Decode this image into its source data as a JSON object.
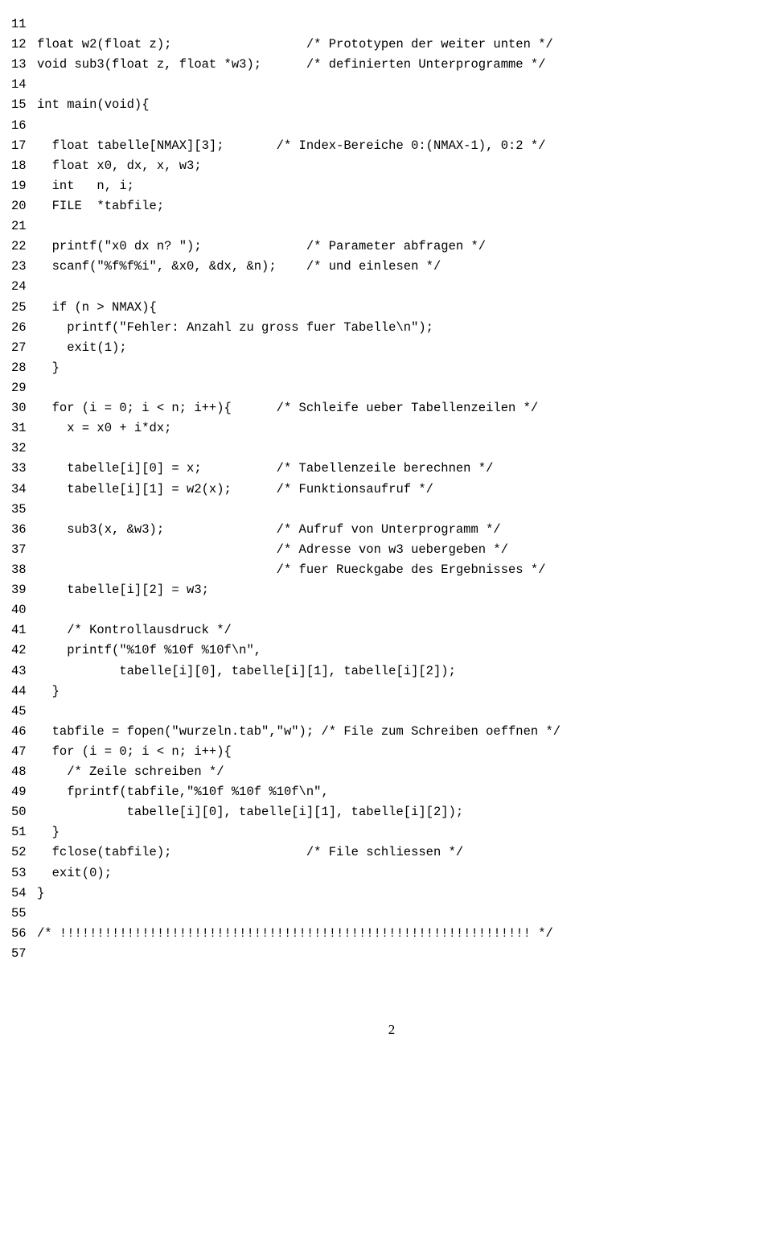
{
  "code_lines": [
    {
      "num": "11",
      "text": ""
    },
    {
      "num": "12",
      "text": "float w2(float z);                  /* Prototypen der weiter unten */"
    },
    {
      "num": "13",
      "text": "void sub3(float z, float *w3);      /* definierten Unterprogramme */"
    },
    {
      "num": "14",
      "text": ""
    },
    {
      "num": "15",
      "text": "int main(void){"
    },
    {
      "num": "16",
      "text": ""
    },
    {
      "num": "17",
      "text": "  float tabelle[NMAX][3];       /* Index-Bereiche 0:(NMAX-1), 0:2 */"
    },
    {
      "num": "18",
      "text": "  float x0, dx, x, w3;"
    },
    {
      "num": "19",
      "text": "  int   n, i;"
    },
    {
      "num": "20",
      "text": "  FILE  *tabfile;"
    },
    {
      "num": "21",
      "text": ""
    },
    {
      "num": "22",
      "text": "  printf(\"x0 dx n? \");              /* Parameter abfragen */"
    },
    {
      "num": "23",
      "text": "  scanf(\"%f%f%i\", &x0, &dx, &n);    /* und einlesen */"
    },
    {
      "num": "24",
      "text": ""
    },
    {
      "num": "25",
      "text": "  if (n > NMAX){"
    },
    {
      "num": "26",
      "text": "    printf(\"Fehler: Anzahl zu gross fuer Tabelle\\n\");"
    },
    {
      "num": "27",
      "text": "    exit(1);"
    },
    {
      "num": "28",
      "text": "  }"
    },
    {
      "num": "29",
      "text": ""
    },
    {
      "num": "30",
      "text": "  for (i = 0; i < n; i++){      /* Schleife ueber Tabellenzeilen */"
    },
    {
      "num": "31",
      "text": "    x = x0 + i*dx;"
    },
    {
      "num": "32",
      "text": ""
    },
    {
      "num": "33",
      "text": "    tabelle[i][0] = x;          /* Tabellenzeile berechnen */"
    },
    {
      "num": "34",
      "text": "    tabelle[i][1] = w2(x);      /* Funktionsaufruf */"
    },
    {
      "num": "35",
      "text": ""
    },
    {
      "num": "36",
      "text": "    sub3(x, &w3);               /* Aufruf von Unterprogramm */"
    },
    {
      "num": "37",
      "text": "                                /* Adresse von w3 uebergeben */"
    },
    {
      "num": "38",
      "text": "                                /* fuer Rueckgabe des Ergebnisses */"
    },
    {
      "num": "39",
      "text": "    tabelle[i][2] = w3;"
    },
    {
      "num": "40",
      "text": ""
    },
    {
      "num": "41",
      "text": "    /* Kontrollausdruck */"
    },
    {
      "num": "42",
      "text": "    printf(\"%10f %10f %10f\\n\","
    },
    {
      "num": "43",
      "text": "           tabelle[i][0], tabelle[i][1], tabelle[i][2]);"
    },
    {
      "num": "44",
      "text": "  }"
    },
    {
      "num": "45",
      "text": ""
    },
    {
      "num": "46",
      "text": "  tabfile = fopen(\"wurzeln.tab\",\"w\"); /* File zum Schreiben oeffnen */"
    },
    {
      "num": "47",
      "text": "  for (i = 0; i < n; i++){"
    },
    {
      "num": "48",
      "text": "    /* Zeile schreiben */"
    },
    {
      "num": "49",
      "text": "    fprintf(tabfile,\"%10f %10f %10f\\n\","
    },
    {
      "num": "50",
      "text": "            tabelle[i][0], tabelle[i][1], tabelle[i][2]);"
    },
    {
      "num": "51",
      "text": "  }"
    },
    {
      "num": "52",
      "text": "  fclose(tabfile);                  /* File schliessen */"
    },
    {
      "num": "53",
      "text": "  exit(0);"
    },
    {
      "num": "54",
      "text": "}"
    },
    {
      "num": "55",
      "text": ""
    },
    {
      "num": "56",
      "text": "/* !!!!!!!!!!!!!!!!!!!!!!!!!!!!!!!!!!!!!!!!!!!!!!!!!!!!!!!!!!!!!!! */"
    },
    {
      "num": "57",
      "text": ""
    }
  ],
  "page_number": "2"
}
